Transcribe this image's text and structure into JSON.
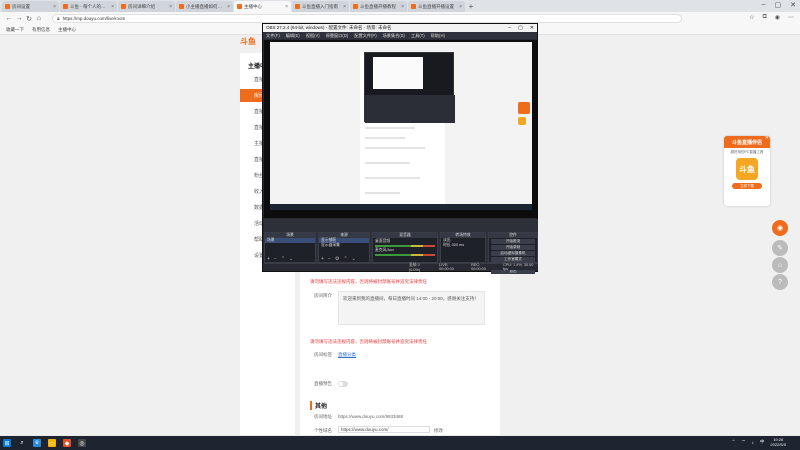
{
  "browser": {
    "tabs": [
      {
        "label": "房间设置"
      },
      {
        "label": "斗鱼 - 每个人的直播平台"
      },
      {
        "label": "房间详细介绍"
      },
      {
        "label": "小主播直播如何设置开播"
      },
      {
        "label": "主播中心"
      },
      {
        "label": "斗鱼直播入门指南"
      },
      {
        "label": "斗鱼直播开播教程"
      },
      {
        "label": "斗鱼直播开播设置"
      }
    ],
    "active_tab": 4,
    "url": "https://mp.douyu.com/live/room",
    "bookmarks": [
      "收藏一下",
      "有用信息",
      "主播中心"
    ]
  },
  "page": {
    "logo": "斗鱼",
    "leftnav_title": "主播中心",
    "leftnav_items": [
      "直播",
      "房间",
      "直播",
      "直播",
      "主播",
      "直播",
      "粉丝",
      "收入",
      "数据",
      "活动",
      "帮助",
      "设置"
    ],
    "form": {
      "desc_label": "房间简介",
      "desc_text": "欢迎来到我的直播间，每日直播时间 14:00 - 20:00，感谢关注支持！",
      "warn1": "请勿填写违法违规内容，否则将被封禁账号并追究法律责任",
      "warn2": "请勿填写违法违规内容，否则将被封禁账号并追究法律责任",
      "apply_label": "房间标签",
      "apply_link": "直播分类",
      "toggle_label": "直播预告",
      "section_title": "其他",
      "room_link_label": "房间地址",
      "room_link_value": "https://www.douyu.com/9933488",
      "share_label": "个性域名",
      "share_value": "https://www.douyu.com/",
      "share_btn": "修改"
    }
  },
  "promo": {
    "title": "斗鱼直播伴侣",
    "subtitle": "超好用的PC直播工具",
    "app_label": "斗鱼",
    "button": "立即下载"
  },
  "obs": {
    "title": "OBS 27.2.4 (64-bit, windows) - 配置文件: 未命名 - 场景: 未命名",
    "menu": [
      "文件(F)",
      "编辑(E)",
      "视图(V)",
      "停靠窗口(D)",
      "配置文件(P)",
      "场景集合(S)",
      "工具(T)",
      "帮助(H)"
    ],
    "dock_labels": [
      "场景",
      "来源",
      "混音器",
      "转场特效",
      "控件"
    ],
    "scene_items": [
      "场景"
    ],
    "source_items": [
      "显示捕获",
      "显示器采集"
    ],
    "mixer_items": [
      {
        "name": "桌面音频",
        "db": "0.0 dB"
      },
      {
        "name": "麦克风/Aux",
        "db": "0.0 dB"
      }
    ],
    "transition": {
      "type": "淡出",
      "duration_label": "时长",
      "duration": "300 ms"
    },
    "controls": [
      "开始推流",
      "开始录制",
      "启动虚拟摄像机",
      "工作室模式",
      "设置",
      "退出"
    ],
    "status": [
      "丢帧 0 (0.0%)",
      "LIVE: 00:00:00",
      "REC: 00:00:00",
      "CPU: 1.4%, 30.00 fps"
    ]
  },
  "taskbar": {
    "time": "19:26",
    "date": "2022/5/5",
    "lang": "中"
  },
  "colors": {
    "accent": "#f06c1d",
    "obs_bg": "#272a33"
  }
}
